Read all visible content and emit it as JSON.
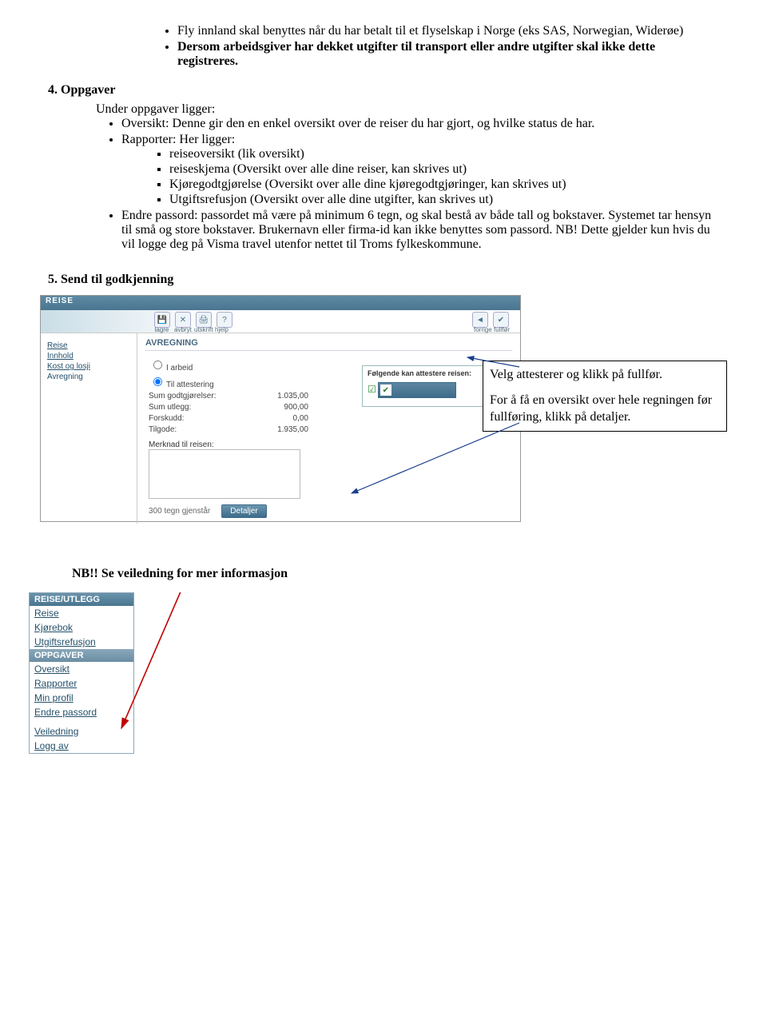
{
  "topBullets": {
    "b1": "Fly innland skal benyttes når du har betalt til et flyselskap i Norge (eks SAS, Norwegian, Widerøe)",
    "b2a": "Dersom arbeidsgiver har dekket utgifter til transport eller andre utgifter skal ikke dette registreres.",
    "b2b": ""
  },
  "oppgaverHeading": "4.  Oppgaver",
  "underOppgaver": "Under oppgaver ligger:",
  "oversiktBullet": "Oversikt: Denne gir den en enkel oversikt over de reiser du har gjort, og hvilke status de har.",
  "rapporterLabel": "Rapporter: Her ligger:",
  "rapporter": {
    "r1": "reiseoversikt (lik oversikt)",
    "r2": "reiseskjema (Oversikt over alle dine reiser, kan skrives ut)",
    "r3": "Kjøregodtgjørelse (Oversikt over alle dine kjøregodtgjøringer, kan skrives ut)",
    "r4": "Utgiftsrefusjon (Oversikt over alle dine utgifter, kan skrives ut)"
  },
  "endrePassord": "Endre passord: passordet må være på minimum 6 tegn, og skal bestå av både tall og bokstaver. Systemet tar hensyn til små og store bokstaver. Brukernavn eller firma-id kan ikke benyttes som passord. NB! Dette gjelder kun hvis du vil logge deg på Visma travel utenfor nettet til Troms fylkeskommune.",
  "sendHeading": "5.  Send til godkjenning",
  "app": {
    "tab": "REISE",
    "toolbar": {
      "lagre": "lagre",
      "avbryt": "avbryt",
      "utskrift": "utskrift",
      "hjelp": "hjelp",
      "forrige": "forrige",
      "fullfor": "fullfør"
    },
    "sidebar": {
      "reise": "Reise",
      "innhold": "Innhold",
      "kost": "Kost og losji",
      "avregning": "Avregning"
    },
    "section": "AVREGNING",
    "radio1": "I arbeid",
    "radio2": "Til attestering",
    "rows": {
      "sumGodt": {
        "lbl": "Sum godtgjørelser:",
        "val": "1.035,00"
      },
      "sumUtl": {
        "lbl": "Sum utlegg:",
        "val": "900,00"
      },
      "forskudd": {
        "lbl": "Forskudd:",
        "val": "0,00"
      },
      "tilgode": {
        "lbl": "Tilgode:",
        "val": "1.935,00"
      }
    },
    "merknad": "Merknad til reisen:",
    "tegn": "300 tegn gjenstår",
    "detaljer": "Detaljer",
    "attestTitle": "Følgende kan attestere reisen:"
  },
  "callout": {
    "line1": "Velg attesterer og klikk på fullfør.",
    "line2": "For å få en oversikt over hele regningen før fullføring, klikk på detaljer."
  },
  "nbLine": "NB!! Se veiledning for mer informasjon",
  "menu": {
    "hdr1": "REISE/UTLEGG",
    "i1": "Reise",
    "i2": "Kjørebok",
    "i3": "Utgiftsrefusjon",
    "hdr2": "OPPGAVER",
    "i4": "Oversikt",
    "i5": "Rapporter",
    "i6": "Min profil",
    "i7": "Endre passord",
    "i8": "Veiledning",
    "i9": "Logg av"
  }
}
